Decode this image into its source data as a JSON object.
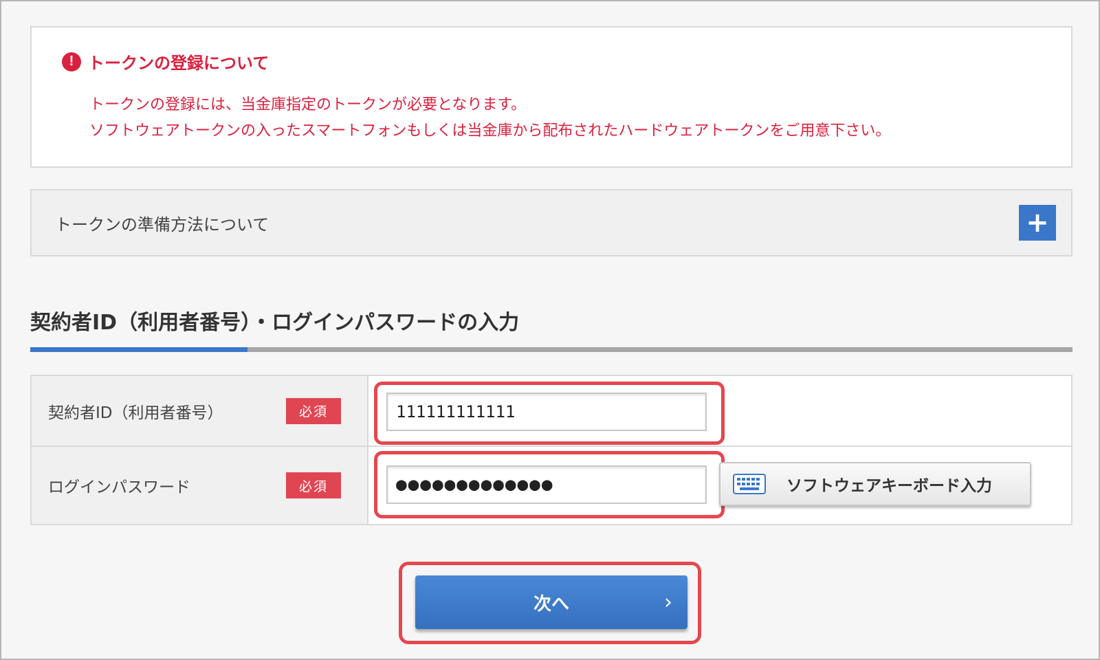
{
  "notice": {
    "icon": "exclamation-circle-icon",
    "title": "トークンの登録について",
    "line1": "トークンの登録には、当金庫指定のトークンが必要となります。",
    "line2": "ソフトウェアトークンの入ったスマートフォンもしくは当金庫から配布されたハードウェアトークンをご用意下さい。",
    "color": "#d9213f"
  },
  "accordion": {
    "label": "トークンの準備方法について",
    "toggle_icon": "plus-icon",
    "toggle_symbol": "+"
  },
  "section": {
    "title": "契約者ID（利用者番号）・ログインパスワードの入力"
  },
  "form": {
    "required_badge": "必須",
    "contract_id": {
      "label": "契約者ID（利用者番号）",
      "value": "111111111111"
    },
    "password": {
      "label": "ログインパスワード",
      "value": "●●●●●●●●●●●●●"
    },
    "software_keyboard": {
      "icon": "keyboard-icon",
      "label": "ソフトウェアキーボード入力"
    }
  },
  "next_button": {
    "label": "次へ",
    "chevron": "›"
  },
  "colors": {
    "accent": "#3a77c9",
    "required": "#e04552",
    "highlight": "#e5474f"
  }
}
